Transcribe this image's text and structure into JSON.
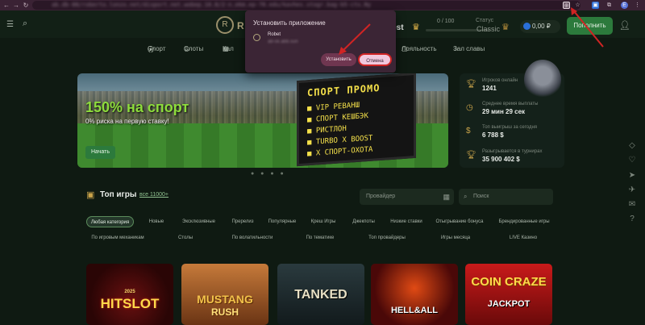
{
  "browser": {
    "url": "ab.db-88/roberto.lonzo.net/disport.net.wobep.10.8/2-n.ekm.ep-78.edu/kavhes.stogr.bag-b5-cts.Ny",
    "icons": [
      "back-icon",
      "forward-icon",
      "reload-icon",
      "install-app-icon",
      "star-icon",
      "extension-icon",
      "puzzle-icon",
      "profile-avatar",
      "menu-icon"
    ],
    "profile_letter": "E"
  },
  "header": {
    "logo_letter": "R",
    "logo_text": "R",
    "user": "uest",
    "progress": {
      "text": "0 / 100",
      "value": 0
    },
    "tier_label": "Статус",
    "tier_name": "Classic",
    "balance": "0,00 ₽",
    "deposit_label": "Пополнить"
  },
  "nav": [
    {
      "label": "Спорт",
      "icon": "soccer-ball-icon"
    },
    {
      "label": "Слоты",
      "icon": "slots-icon"
    },
    {
      "label": "Кал",
      "icon": "calendar-icon"
    },
    {
      "label": "Лояльность",
      "icon": "gift-icon"
    },
    {
      "label": "Зал славы",
      "icon": "star-outline-icon"
    }
  ],
  "popup": {
    "title": "Установить приложение",
    "app_name": "Robet",
    "app_url": "ab-sk.abb.sun",
    "install_label": "Установить",
    "cancel_label": "Отмена"
  },
  "banner": {
    "title": "150% на спорт",
    "subtitle": "0% риска на первую ставку!",
    "button": "Начать",
    "board_title": "СПОРТ ПРОМО",
    "board_lines": [
      "VIP РЕВАНШ",
      "СПОРТ КЕШБЭК",
      "РИСТЛОН",
      "TURBO X BOOST",
      "X СПОРТ-ОХОТА"
    ],
    "dots": "● ● ● ●"
  },
  "stats": [
    {
      "label": "Игроков онлайн",
      "value": "1241",
      "icon": "trophy-cup-icon"
    },
    {
      "label": "Среднее время выплаты",
      "value": "29 мин 29 сек",
      "icon": "stopwatch-icon"
    },
    {
      "label": "Топ выигрыш за сегодня",
      "value": "6 788 $",
      "icon": "money-bag-icon"
    },
    {
      "label": "Разыгрывается в турнирах",
      "value": "35 900 402 $",
      "icon": "trophy-icon"
    }
  ],
  "top_games": {
    "title": "Топ игры",
    "all_link": "все 11000+",
    "provider_placeholder": "Провайдер",
    "search_placeholder": "Поиск",
    "chips_row1": [
      "Любая категория",
      "Новые",
      "Эксклюзивные",
      "Пререлиз",
      "Популярные",
      "Креш Игры",
      "Джекпоты",
      "Низкие ставки",
      "Отыгрывание бонуса",
      "Брендированные игры"
    ],
    "chips_row2": [
      "По игровым механикам",
      "Столы",
      "По волатильности",
      "По тематике",
      "Топ провайдеры",
      "Игры месяца",
      "LIVE Казино"
    ]
  },
  "games": [
    {
      "title": "HITSLOT",
      "subtitle": "2025"
    },
    {
      "title": "MUSTANG",
      "subtitle": "RUSH"
    },
    {
      "title": "TANKED",
      "subtitle": ""
    },
    {
      "title": "HELL&ALL",
      "subtitle": ""
    },
    {
      "title": "COIN CRAZE",
      "subtitle": "JACKPOT"
    }
  ],
  "colors": {
    "accent_green": "#2c7a3c",
    "banner_title": "#8ddc3c",
    "board_text": "#f4e04a",
    "annotation_red": "#d02424"
  }
}
